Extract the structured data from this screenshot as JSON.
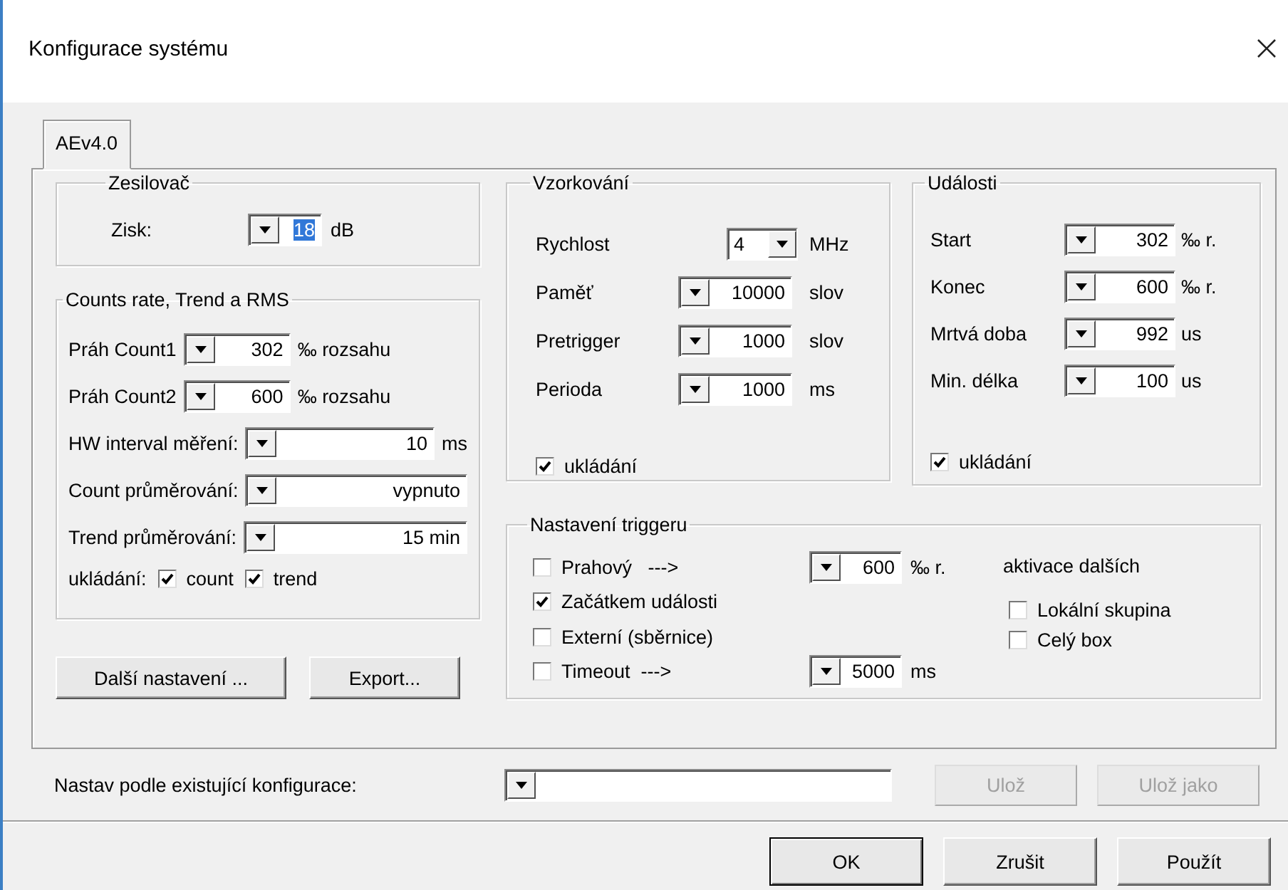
{
  "window": {
    "title": "Konfigurace systému"
  },
  "tabs": [
    {
      "label": "AEv4.0",
      "selected": true
    }
  ],
  "amplifier": {
    "title": "Zesilovač",
    "label": "Zisk:",
    "value": "18",
    "value_selected": true,
    "unit": "dB"
  },
  "counts": {
    "title": "Counts rate, Trend a RMS",
    "fields": [
      {
        "label": "Práh Count1",
        "value": "302",
        "unit": "‰ rozsahu"
      },
      {
        "label": "Práh Count2",
        "value": "600",
        "unit": "‰ rozsahu"
      },
      {
        "label": "HW interval měření:",
        "value": "10",
        "unit": "ms"
      },
      {
        "label": "Count průměrování:",
        "value": "vypnuto"
      },
      {
        "label": "Trend průměrování:",
        "value": "15 min"
      }
    ],
    "save_label": "ukládání:",
    "save_options": [
      {
        "label": "count",
        "checked": true
      },
      {
        "label": "trend",
        "checked": true
      }
    ]
  },
  "left_buttons": [
    "Další nastavení ...",
    "Export..."
  ],
  "sampling": {
    "title": "Vzorkování",
    "fields": [
      {
        "kind": "select",
        "label": "Rychlost",
        "value": "4",
        "unit": "MHz"
      },
      {
        "kind": "combo",
        "label": "Paměť",
        "value": "10000",
        "unit": "slov"
      },
      {
        "kind": "combo",
        "label": "Pretrigger",
        "value": "1000",
        "unit": "slov"
      },
      {
        "kind": "combo",
        "label": "Perioda",
        "value": "1000",
        "unit": "ms"
      }
    ],
    "save": {
      "label": "ukládání",
      "checked": true
    }
  },
  "events": {
    "title": "Události",
    "fields": [
      {
        "label": "Start",
        "value": "302",
        "unit": "‰ r."
      },
      {
        "label": "Konec",
        "value": "600",
        "unit": "‰ r."
      },
      {
        "label": "Mrtvá doba",
        "value": "992",
        "unit": "us"
      },
      {
        "label": "Min. délka",
        "value": "100",
        "unit": "us"
      }
    ],
    "save": {
      "label": "ukládání",
      "checked": true
    }
  },
  "trigger": {
    "title": "Nastavení triggeru",
    "options": [
      {
        "label": "Prahový   --->",
        "checked": false,
        "input": {
          "value": "600",
          "unit": "‰ r."
        }
      },
      {
        "label": "Začátkem události",
        "checked": true
      },
      {
        "label": "Externí (sběrnice)",
        "checked": false
      },
      {
        "label": "Timeout  --->",
        "checked": false,
        "input": {
          "value": "5000",
          "unit": "ms"
        }
      }
    ],
    "activation_label": "aktivace dalších",
    "activation": [
      {
        "label": "Lokální skupina",
        "checked": false
      },
      {
        "label": "Celý box",
        "checked": false
      }
    ]
  },
  "preset": {
    "label": "Nastav podle existující konfigurace:",
    "buttons": [
      {
        "label": "Ulož",
        "disabled": true
      },
      {
        "label": "Ulož jako",
        "disabled": true
      }
    ]
  },
  "dialog_buttons": [
    "OK",
    "Zrušit",
    "Použít"
  ]
}
